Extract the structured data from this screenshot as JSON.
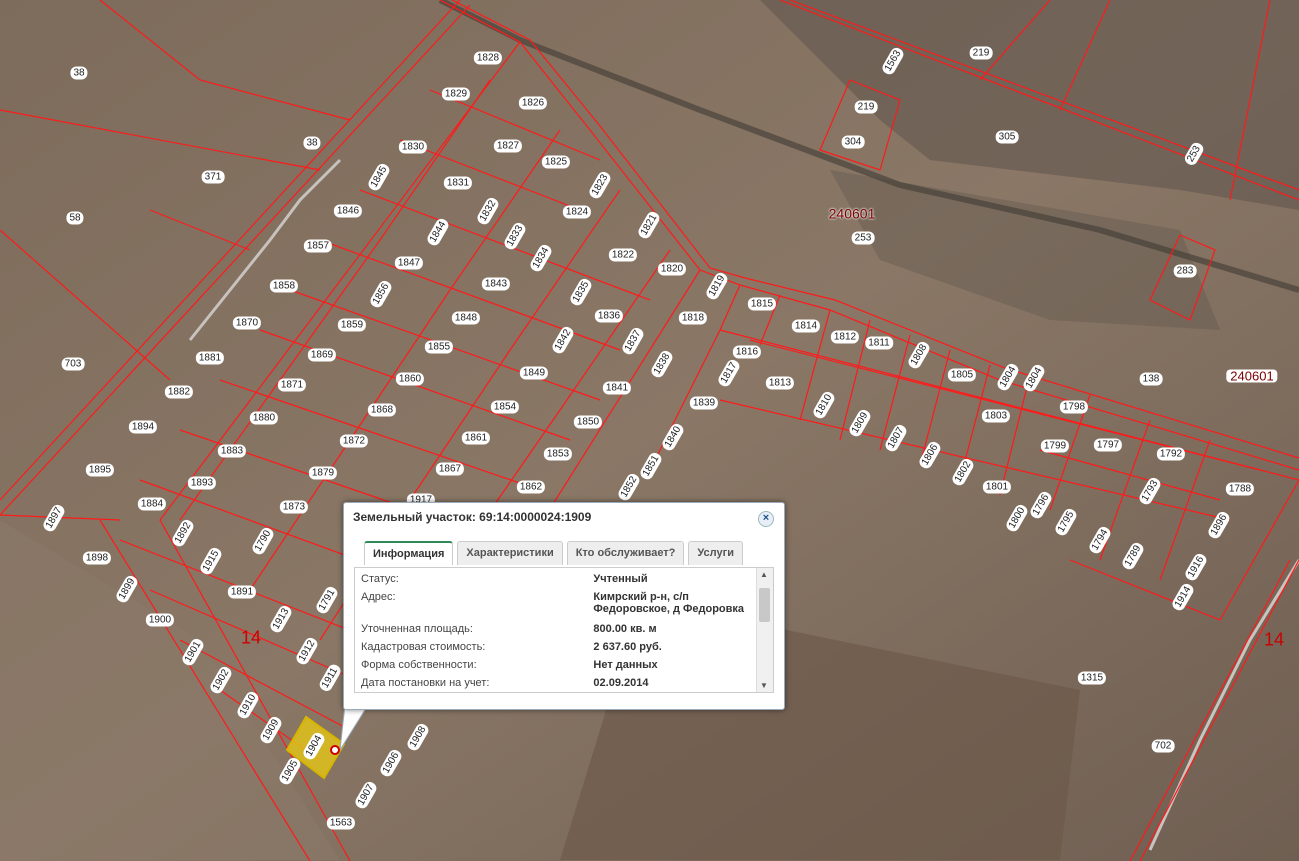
{
  "map": {
    "quarter_labels": [
      "240601",
      "240601"
    ],
    "zone_labels": [
      "14",
      "14"
    ],
    "parcel_labels": [
      "1828",
      "1829",
      "1826",
      "1830",
      "1827",
      "1825",
      "1845",
      "1831",
      "1823",
      "1846",
      "1832",
      "1824",
      "1821",
      "1857",
      "1844",
      "1833",
      "1822",
      "1834",
      "1820",
      "1858",
      "1847",
      "1843",
      "1835",
      "1819",
      "1815",
      "1870",
      "1856",
      "1848",
      "1836",
      "1818",
      "1814",
      "1812",
      "1811",
      "1808",
      "1805",
      "1804",
      "1804",
      "1859",
      "1842",
      "1837",
      "1816",
      "1881",
      "1869",
      "1855",
      "1838",
      "1817",
      "1813",
      "1803",
      "1798",
      "1871",
      "1849",
      "1841",
      "1882",
      "1860",
      "1839",
      "1810",
      "1809",
      "1807",
      "1806",
      "1802",
      "1799",
      "1797",
      "1792",
      "1894",
      "1880",
      "1868",
      "1854",
      "1850",
      "1840",
      "1883",
      "1872",
      "1861",
      "1853",
      "1851",
      "1895",
      "1893",
      "1879",
      "1867",
      "1862",
      "1852",
      "1793",
      "1788",
      "1801",
      "1800",
      "1796",
      "1795",
      "1794",
      "1789",
      "1896",
      "1884",
      "1873",
      "1917",
      "1897",
      "1892",
      "1790",
      "1916",
      "1898",
      "1915",
      "1899",
      "1891",
      "1791",
      "1914",
      "1900",
      "1913",
      "1901",
      "1912",
      "1902",
      "1911",
      "1910",
      "1909",
      "1904",
      "1908",
      "1905",
      "1906",
      "1907",
      "1563",
      "1563",
      "305",
      "219",
      "219",
      "304",
      "253",
      "253",
      "138",
      "283",
      "1315",
      "702",
      "58",
      "38",
      "38",
      "371",
      "703"
    ]
  },
  "popup": {
    "title": "Земельный участок: 69:14:0000024:1909",
    "close_glyph": "×",
    "tabs": [
      "Информация",
      "Характеристики",
      "Кто обслуживает?",
      "Услуги"
    ],
    "active_tab": "Информация",
    "rows": [
      {
        "key": "Статус:",
        "value": "Учтенный"
      },
      {
        "key": "Адрес:",
        "value": "Кимрский р-н, с/п Федоровское, д Федоровка"
      },
      {
        "key": "Уточненная площадь:",
        "value": "800.00 кв. м"
      },
      {
        "key": "Кадастровая стоимость:",
        "value": "2 637.60 руб."
      },
      {
        "key": "Форма собственности:",
        "value": "Нет данных"
      },
      {
        "key": "Дата постановки на учет:",
        "value": "02.09.2014"
      }
    ]
  },
  "colors": {
    "boundary": "#ff1a1a",
    "highlight": "#e0c21a",
    "accent": "#2e8b57"
  }
}
